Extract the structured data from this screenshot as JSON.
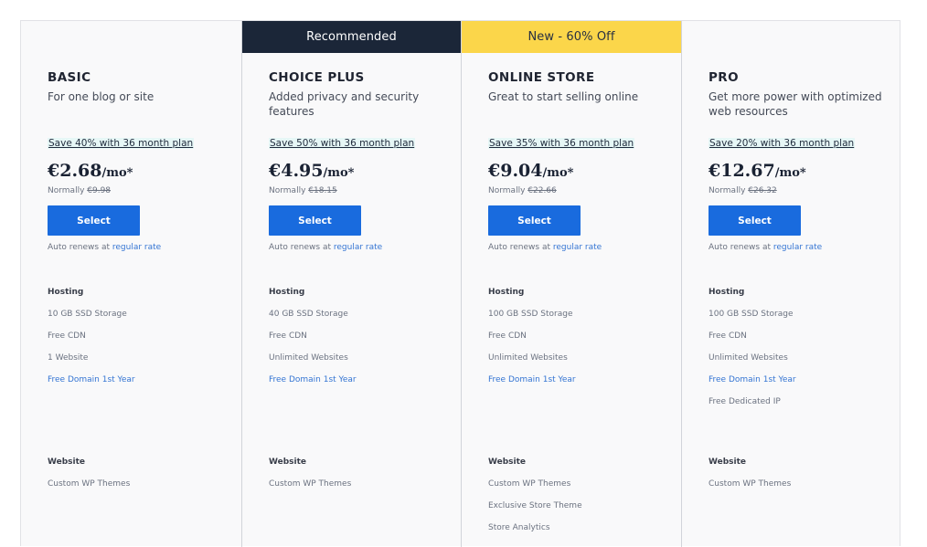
{
  "plans": [
    {
      "banner": "",
      "name": "BASIC",
      "description": "For one blog or site",
      "save_tag": "Save 40% with 36 month plan",
      "price": "€2.68",
      "price_suffix": "/mo*",
      "normally_label": "Normally ",
      "normal_price": "€9.98",
      "select_label": "Select",
      "renews_text": "Auto renews at ",
      "renews_link": "regular rate",
      "hosting_title": "Hosting",
      "hosting_features": [
        "10 GB SSD Storage",
        "Free CDN",
        "1 Website",
        "Free Domain 1st Year"
      ],
      "website_title": "Website",
      "website_features": [
        "Custom WP Themes"
      ]
    },
    {
      "banner": "Recommended",
      "name": "CHOICE PLUS",
      "description": "Added privacy and security features",
      "save_tag": "Save 50% with 36 month plan",
      "price": "€4.95",
      "price_suffix": "/mo*",
      "normally_label": "Normally ",
      "normal_price": "€18.15",
      "select_label": "Select",
      "renews_text": "Auto renews at ",
      "renews_link": "regular rate",
      "hosting_title": "Hosting",
      "hosting_features": [
        "40 GB SSD Storage",
        "Free CDN",
        "Unlimited Websites",
        "Free Domain 1st Year"
      ],
      "website_title": "Website",
      "website_features": [
        "Custom WP Themes"
      ]
    },
    {
      "banner": "New - 60% Off",
      "name": "ONLINE STORE",
      "description": "Great to start selling online",
      "save_tag": "Save 35% with 36 month plan",
      "price": "€9.04",
      "price_suffix": "/mo*",
      "normally_label": "Normally ",
      "normal_price": "€22.66",
      "select_label": "Select",
      "renews_text": "Auto renews at ",
      "renews_link": "regular rate",
      "hosting_title": "Hosting",
      "hosting_features": [
        "100 GB SSD Storage",
        "Free CDN",
        "Unlimited Websites",
        "Free Domain 1st Year"
      ],
      "website_title": "Website",
      "website_features": [
        "Custom WP Themes",
        "Exclusive Store Theme",
        "Store Analytics"
      ]
    },
    {
      "banner": "",
      "name": "PRO",
      "description": "Get more power with optimized web resources",
      "save_tag": "Save 20% with 36 month plan",
      "price": "€12.67",
      "price_suffix": "/mo*",
      "normally_label": "Normally ",
      "normal_price": "€26.32",
      "select_label": "Select",
      "renews_text": "Auto renews at ",
      "renews_link": "regular rate",
      "hosting_title": "Hosting",
      "hosting_features": [
        "100 GB SSD Storage",
        "Free CDN",
        "Unlimited Websites",
        "Free Domain 1st Year",
        "Free Dedicated IP"
      ],
      "website_title": "Website",
      "website_features": [
        "Custom WP Themes"
      ]
    }
  ],
  "colors": {
    "select_button": "#196bde",
    "banner_recommended": "#1b2638",
    "banner_offer": "#fbd64a",
    "link": "#3575d3",
    "save_tag_highlight": "#e6f7f6"
  }
}
